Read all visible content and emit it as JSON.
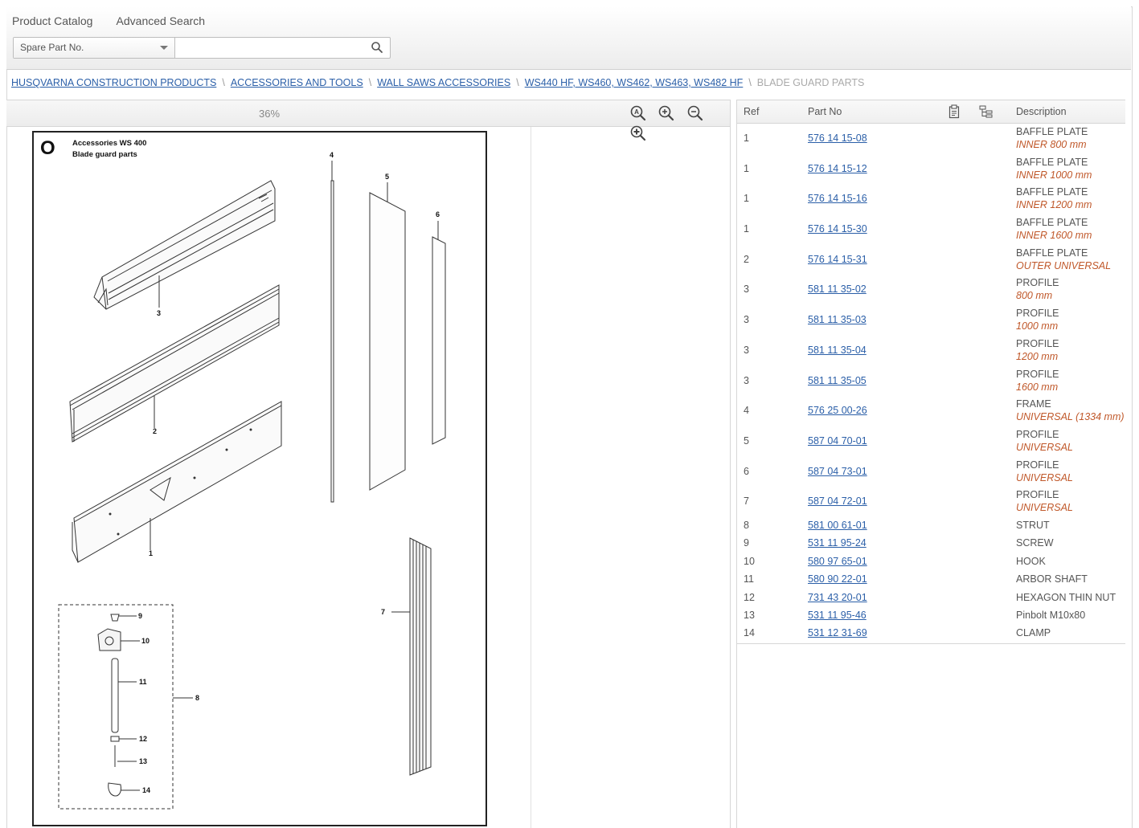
{
  "topnav": {
    "catalog": "Product Catalog",
    "advanced": "Advanced Search"
  },
  "search": {
    "selected": "Spare Part No.",
    "value": ""
  },
  "breadcrumb": [
    {
      "label": "HUSQVARNA CONSTRUCTION PRODUCTS",
      "link": true
    },
    {
      "label": "ACCESSORIES AND TOOLS",
      "link": true
    },
    {
      "label": "WALL SAWS ACCESSORIES",
      "link": true
    },
    {
      "label": "WS440 HF, WS460, WS462, WS463, WS482 HF",
      "link": true
    },
    {
      "label": "BLADE GUARD PARTS",
      "link": false
    }
  ],
  "viewer": {
    "zoom": "36%"
  },
  "drawing": {
    "letter": "O",
    "title": "Accessories WS 400",
    "subtitle": "Blade guard parts",
    "callouts": [
      "1",
      "2",
      "3",
      "4",
      "5",
      "6",
      "7",
      "8",
      "9",
      "10",
      "11",
      "12",
      "13",
      "14"
    ]
  },
  "parts": {
    "headers": {
      "ref": "Ref",
      "part_no": "Part No",
      "description": "Description"
    },
    "rows": [
      {
        "ref": "1",
        "part_no": "576 14 15-08",
        "desc": "BAFFLE PLATE",
        "note": "INNER 800 mm"
      },
      {
        "ref": "1",
        "part_no": "576 14 15-12",
        "desc": "BAFFLE PLATE",
        "note": "INNER 1000 mm"
      },
      {
        "ref": "1",
        "part_no": "576 14 15-16",
        "desc": "BAFFLE PLATE",
        "note": "INNER 1200 mm"
      },
      {
        "ref": "1",
        "part_no": "576 14 15-30",
        "desc": "BAFFLE PLATE",
        "note": "INNER 1600 mm"
      },
      {
        "ref": "2",
        "part_no": "576 14 15-31",
        "desc": "BAFFLE PLATE",
        "note": "OUTER UNIVERSAL"
      },
      {
        "ref": "3",
        "part_no": "581 11 35-02",
        "desc": "PROFILE",
        "note": "800 mm"
      },
      {
        "ref": "3",
        "part_no": "581 11 35-03",
        "desc": "PROFILE",
        "note": "1000 mm"
      },
      {
        "ref": "3",
        "part_no": "581 11 35-04",
        "desc": "PROFILE",
        "note": "1200 mm"
      },
      {
        "ref": "3",
        "part_no": "581 11 35-05",
        "desc": "PROFILE",
        "note": "1600 mm"
      },
      {
        "ref": "4",
        "part_no": "576 25 00-26",
        "desc": "FRAME",
        "note": "UNIVERSAL (1334 mm)"
      },
      {
        "ref": "5",
        "part_no": "587 04 70-01",
        "desc": "PROFILE",
        "note": "UNIVERSAL"
      },
      {
        "ref": "6",
        "part_no": "587 04 73-01",
        "desc": "PROFILE",
        "note": "UNIVERSAL"
      },
      {
        "ref": "7",
        "part_no": "587 04 72-01",
        "desc": "PROFILE",
        "note": "UNIVERSAL"
      },
      {
        "ref": "8",
        "part_no": "581 00 61-01",
        "desc": "STRUT",
        "note": ""
      },
      {
        "ref": "9",
        "part_no": "531 11 95-24",
        "desc": "SCREW",
        "note": ""
      },
      {
        "ref": "10",
        "part_no": "580 97 65-01",
        "desc": "HOOK",
        "note": ""
      },
      {
        "ref": "11",
        "part_no": "580 90 22-01",
        "desc": "ARBOR SHAFT",
        "note": ""
      },
      {
        "ref": "12",
        "part_no": "731 43 20-01",
        "desc": "HEXAGON THIN NUT",
        "note": ""
      },
      {
        "ref": "13",
        "part_no": "531 11 95-46",
        "desc": "Pinbolt M10x80",
        "note": ""
      },
      {
        "ref": "14",
        "part_no": "531 12 31-69",
        "desc": "CLAMP",
        "note": ""
      }
    ]
  },
  "icons": {
    "search": "search-icon",
    "zoom_fit": "zoom-fit-icon",
    "zoom_in": "zoom-in-icon",
    "zoom_out": "zoom-out-icon",
    "zoom_in_plus": "zoom-in-plus-icon",
    "clipboard": "clipboard-icon",
    "tree": "tree-structure-icon"
  },
  "colors": {
    "link": "#2b5fa8",
    "note": "#c0582a"
  }
}
